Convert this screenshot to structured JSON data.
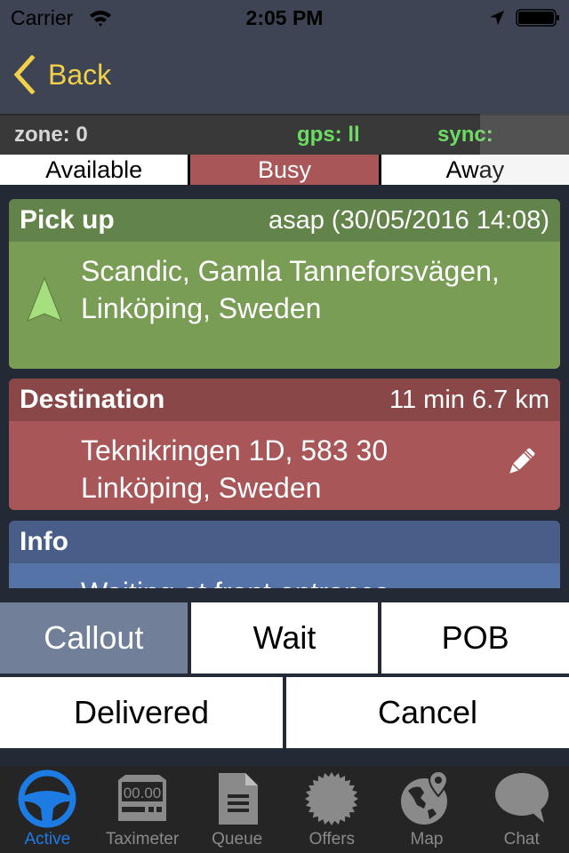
{
  "status_bar": {
    "carrier": "Carrier",
    "time": "2:05 PM",
    "icons": [
      "wifi-icon",
      "location-arrow-icon",
      "battery-icon"
    ]
  },
  "nav": {
    "back_label": "Back",
    "back_icon": "chevron-left-icon",
    "accent_color": "#f1d04a"
  },
  "info_bar": {
    "zone": "zone: 0",
    "gps": "gps: ll",
    "sync": "sync:"
  },
  "driver_status": {
    "options": [
      "Available",
      "Busy",
      "Away"
    ],
    "selected": "Busy",
    "selected_color": "#a85657"
  },
  "pickup": {
    "title": "Pick up",
    "time": "asap (30/05/2016 14:08)",
    "address": "Scandic, Gamla Tanneforsvägen, Linköping, Sweden",
    "icon": "navigation-arrow-icon",
    "color": "#799d55"
  },
  "destination": {
    "title": "Destination",
    "eta": "11 min 6.7 km",
    "address": "Teknikringen 1D, 583 30 Linköping, Sweden",
    "icon": "pencil-icon",
    "color": "#a85657"
  },
  "info": {
    "title": "Info",
    "text": "Waiting at front entrance",
    "color": "#5673a8"
  },
  "actions": {
    "row1": [
      "Callout",
      "Wait",
      "POB"
    ],
    "row2": [
      "Delivered",
      "Cancel"
    ],
    "selected": "Callout"
  },
  "tabs": [
    {
      "label": "Active",
      "icon": "steering-wheel-icon",
      "active": true
    },
    {
      "label": "Taximeter",
      "icon": "taximeter-icon",
      "icon_text": "00.00",
      "active": false
    },
    {
      "label": "Queue",
      "icon": "document-icon",
      "active": false
    },
    {
      "label": "Offers",
      "icon": "badge-icon",
      "active": false
    },
    {
      "label": "Map",
      "icon": "globe-pin-icon",
      "active": false
    },
    {
      "label": "Chat",
      "icon": "speech-bubble-icon",
      "active": false
    }
  ]
}
